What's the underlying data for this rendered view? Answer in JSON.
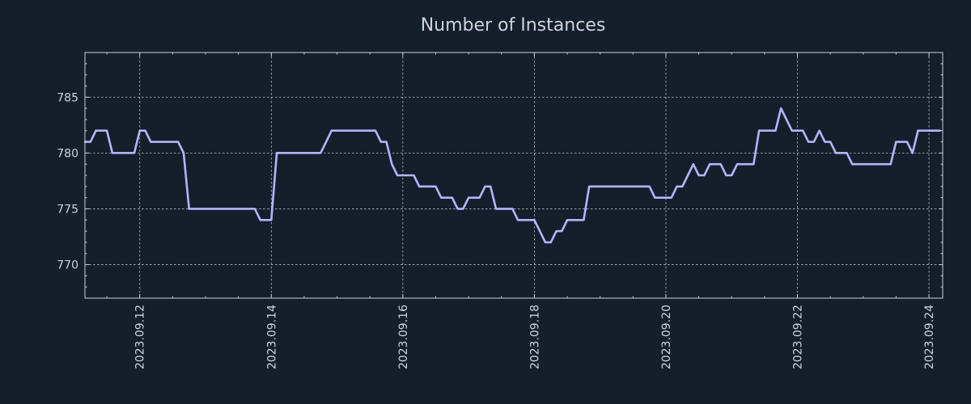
{
  "colors": {
    "background": "#151f2c",
    "text": "#cfd3d8",
    "series": "#b4b4ff"
  },
  "chart_data": {
    "type": "line",
    "title": "Number of Instances",
    "xlabel": "",
    "ylabel": "",
    "grid": true,
    "legend": "none",
    "x_axis": {
      "kind": "date",
      "range": [
        "2023-09-11 04:00",
        "2023-09-24 05:00"
      ]
    },
    "ylim": [
      767,
      789
    ],
    "y_ticks": [
      770,
      775,
      780,
      785
    ],
    "x_ticks": [
      "2023.09.12",
      "2023.09.14",
      "2023.09.16",
      "2023.09.18",
      "2023.09.20",
      "2023.09.22",
      "2023.09.24"
    ],
    "series": [
      {
        "x": [
          "2023-09-11 04:00",
          "2023-09-11 06:00",
          "2023-09-11 08:00",
          "2023-09-11 10:00",
          "2023-09-11 12:00",
          "2023-09-11 14:00",
          "2023-09-11 16:00",
          "2023-09-11 18:00",
          "2023-09-11 20:00",
          "2023-09-11 22:00",
          "2023-09-12 00:00",
          "2023-09-12 02:00",
          "2023-09-12 04:00",
          "2023-09-12 06:00",
          "2023-09-12 08:00",
          "2023-09-12 10:00",
          "2023-09-12 12:00",
          "2023-09-12 14:00",
          "2023-09-12 16:00",
          "2023-09-12 18:00",
          "2023-09-12 20:00",
          "2023-09-12 22:00",
          "2023-09-13 00:00",
          "2023-09-13 02:00",
          "2023-09-13 04:00",
          "2023-09-13 06:00",
          "2023-09-13 08:00",
          "2023-09-13 10:00",
          "2023-09-13 12:00",
          "2023-09-13 14:00",
          "2023-09-13 16:00",
          "2023-09-13 18:00",
          "2023-09-13 20:00",
          "2023-09-13 22:00",
          "2023-09-14 00:00",
          "2023-09-14 02:00",
          "2023-09-14 04:00",
          "2023-09-14 06:00",
          "2023-09-14 08:00",
          "2023-09-14 10:00",
          "2023-09-14 12:00",
          "2023-09-14 14:00",
          "2023-09-14 16:00",
          "2023-09-14 18:00",
          "2023-09-14 20:00",
          "2023-09-14 22:00",
          "2023-09-15 00:00",
          "2023-09-15 02:00",
          "2023-09-15 04:00",
          "2023-09-15 06:00",
          "2023-09-15 08:00",
          "2023-09-15 10:00",
          "2023-09-15 12:00",
          "2023-09-15 14:00",
          "2023-09-15 16:00",
          "2023-09-15 18:00",
          "2023-09-15 20:00",
          "2023-09-15 22:00",
          "2023-09-16 00:00",
          "2023-09-16 02:00",
          "2023-09-16 04:00",
          "2023-09-16 06:00",
          "2023-09-16 08:00",
          "2023-09-16 10:00",
          "2023-09-16 12:00",
          "2023-09-16 14:00",
          "2023-09-16 16:00",
          "2023-09-16 18:00",
          "2023-09-16 20:00",
          "2023-09-16 22:00",
          "2023-09-17 00:00",
          "2023-09-17 02:00",
          "2023-09-17 04:00",
          "2023-09-17 06:00",
          "2023-09-17 08:00",
          "2023-09-17 10:00",
          "2023-09-17 12:00",
          "2023-09-17 14:00",
          "2023-09-17 16:00",
          "2023-09-17 18:00",
          "2023-09-17 20:00",
          "2023-09-17 22:00",
          "2023-09-18 00:00",
          "2023-09-18 02:00",
          "2023-09-18 04:00",
          "2023-09-18 06:00",
          "2023-09-18 08:00",
          "2023-09-18 10:00",
          "2023-09-18 12:00",
          "2023-09-18 14:00",
          "2023-09-18 16:00",
          "2023-09-18 18:00",
          "2023-09-18 20:00",
          "2023-09-18 22:00",
          "2023-09-19 00:00",
          "2023-09-19 02:00",
          "2023-09-19 04:00",
          "2023-09-19 06:00",
          "2023-09-19 08:00",
          "2023-09-19 10:00",
          "2023-09-19 12:00",
          "2023-09-19 14:00",
          "2023-09-19 16:00",
          "2023-09-19 18:00",
          "2023-09-19 20:00",
          "2023-09-19 22:00",
          "2023-09-20 00:00",
          "2023-09-20 02:00",
          "2023-09-20 04:00",
          "2023-09-20 06:00",
          "2023-09-20 08:00",
          "2023-09-20 10:00",
          "2023-09-20 12:00",
          "2023-09-20 14:00",
          "2023-09-20 16:00",
          "2023-09-20 18:00",
          "2023-09-20 20:00",
          "2023-09-20 22:00",
          "2023-09-21 00:00",
          "2023-09-21 02:00",
          "2023-09-21 04:00",
          "2023-09-21 06:00",
          "2023-09-21 08:00",
          "2023-09-21 10:00",
          "2023-09-21 12:00",
          "2023-09-21 14:00",
          "2023-09-21 16:00",
          "2023-09-21 18:00",
          "2023-09-21 20:00",
          "2023-09-21 22:00",
          "2023-09-22 00:00",
          "2023-09-22 02:00",
          "2023-09-22 04:00",
          "2023-09-22 06:00",
          "2023-09-22 08:00",
          "2023-09-22 10:00",
          "2023-09-22 12:00",
          "2023-09-22 14:00",
          "2023-09-22 16:00",
          "2023-09-22 18:00",
          "2023-09-22 20:00",
          "2023-09-22 22:00",
          "2023-09-23 00:00",
          "2023-09-23 02:00",
          "2023-09-23 04:00",
          "2023-09-23 06:00",
          "2023-09-23 08:00",
          "2023-09-23 10:00",
          "2023-09-23 12:00",
          "2023-09-23 14:00",
          "2023-09-23 16:00",
          "2023-09-23 18:00",
          "2023-09-23 20:00",
          "2023-09-23 22:00",
          "2023-09-24 00:00",
          "2023-09-24 02:00",
          "2023-09-24 04:00"
        ],
        "values": [
          781,
          781,
          782,
          782,
          782,
          780,
          780,
          780,
          780,
          780,
          782,
          782,
          781,
          781,
          781,
          781,
          781,
          781,
          780,
          775,
          775,
          775,
          775,
          775,
          775,
          775,
          775,
          775,
          775,
          775,
          775,
          775,
          774,
          774,
          774,
          780,
          780,
          780,
          780,
          780,
          780,
          780,
          780,
          780,
          781,
          782,
          782,
          782,
          782,
          782,
          782,
          782,
          782,
          782,
          781,
          781,
          779,
          778,
          778,
          778,
          778,
          777,
          777,
          777,
          777,
          776,
          776,
          776,
          775,
          775,
          776,
          776,
          776,
          777,
          777,
          775,
          775,
          775,
          775,
          774,
          774,
          774,
          774,
          773,
          772,
          772,
          773,
          773,
          774,
          774,
          774,
          774,
          777,
          777,
          777,
          777,
          777,
          777,
          777,
          777,
          777,
          777,
          777,
          777,
          776,
          776,
          776,
          776,
          777,
          777,
          778,
          779,
          778,
          778,
          779,
          779,
          779,
          778,
          778,
          779,
          779,
          779,
          779,
          782,
          782,
          782,
          782,
          784,
          783,
          782,
          782,
          782,
          781,
          781,
          782,
          781,
          781,
          780,
          780,
          780,
          779,
          779,
          779,
          779,
          779,
          779,
          779,
          779,
          781,
          781,
          781,
          780,
          782,
          782,
          782,
          782,
          782
        ]
      }
    ]
  }
}
